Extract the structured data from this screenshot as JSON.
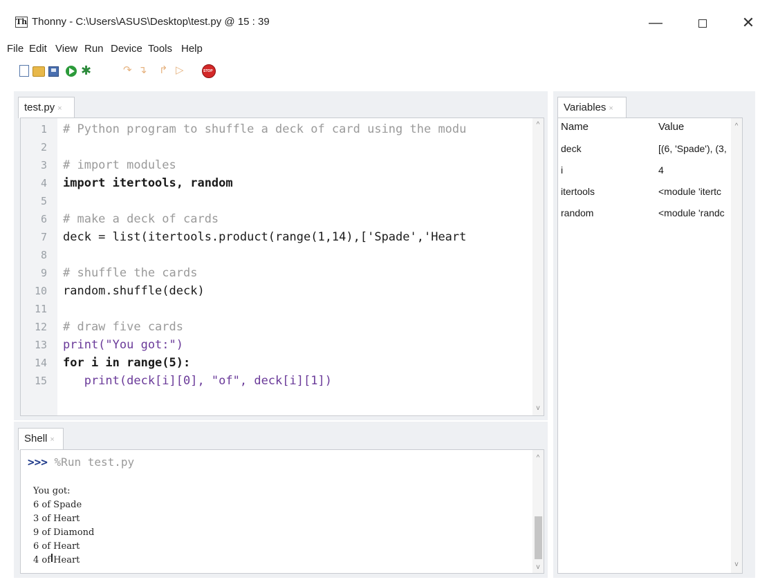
{
  "window": {
    "title": "Thonny  -  C:\\Users\\ASUS\\Desktop\\test.py  @  15 : 39",
    "logo_text": "Th",
    "minimize": "—",
    "close": "✕"
  },
  "menu": [
    "File",
    "Edit",
    "View",
    "Run",
    "Device",
    "Tools",
    "Help"
  ],
  "toolbar": {
    "icons": [
      "new-file-icon",
      "open-file-icon",
      "save-icon",
      "run-icon",
      "debug-icon",
      "step-over-icon",
      "step-into-icon",
      "step-out-icon",
      "resume-icon",
      "stop-icon"
    ]
  },
  "editor": {
    "tab_label": "test.py",
    "tab_close": "×",
    "line_numbers": [
      "1",
      "2",
      "3",
      "4",
      "5",
      "6",
      "7",
      "8",
      "9",
      "10",
      "11",
      "12",
      "13",
      "14",
      "15"
    ],
    "lines": [
      "# Python program to shuffle a deck of card using the modu",
      "",
      "# import modules",
      "import itertools, random",
      "",
      "# make a deck of cards",
      "deck = list(itertools.product(range(1,14),['Spade','Heart",
      "",
      "# shuffle the cards",
      "random.shuffle(deck)",
      "",
      "# draw five cards",
      "print(\"You got:\")",
      "for i in range(5):",
      "   print(deck[i][0], \"of\", deck[i][1])"
    ]
  },
  "shell": {
    "tab_label": "Shell",
    "tab_close": "×",
    "prompt": ">>>",
    "command": "%Run test.py",
    "output": [
      "You got:",
      "6 of Spade",
      "3 of Heart",
      "9 of Diamond",
      "6 of Heart",
      "4 of Heart"
    ]
  },
  "variables": {
    "tab_label": "Variables",
    "tab_close": "×",
    "header": {
      "name": "Name",
      "value": "Value"
    },
    "rows": [
      {
        "name": "deck",
        "value": "[(6, 'Spade'), (3,"
      },
      {
        "name": "i",
        "value": "4"
      },
      {
        "name": "itertools",
        "value": "<module 'itertc"
      },
      {
        "name": "random",
        "value": "<module 'randc"
      }
    ]
  },
  "scroll": {
    "up": "^",
    "down": "v"
  }
}
